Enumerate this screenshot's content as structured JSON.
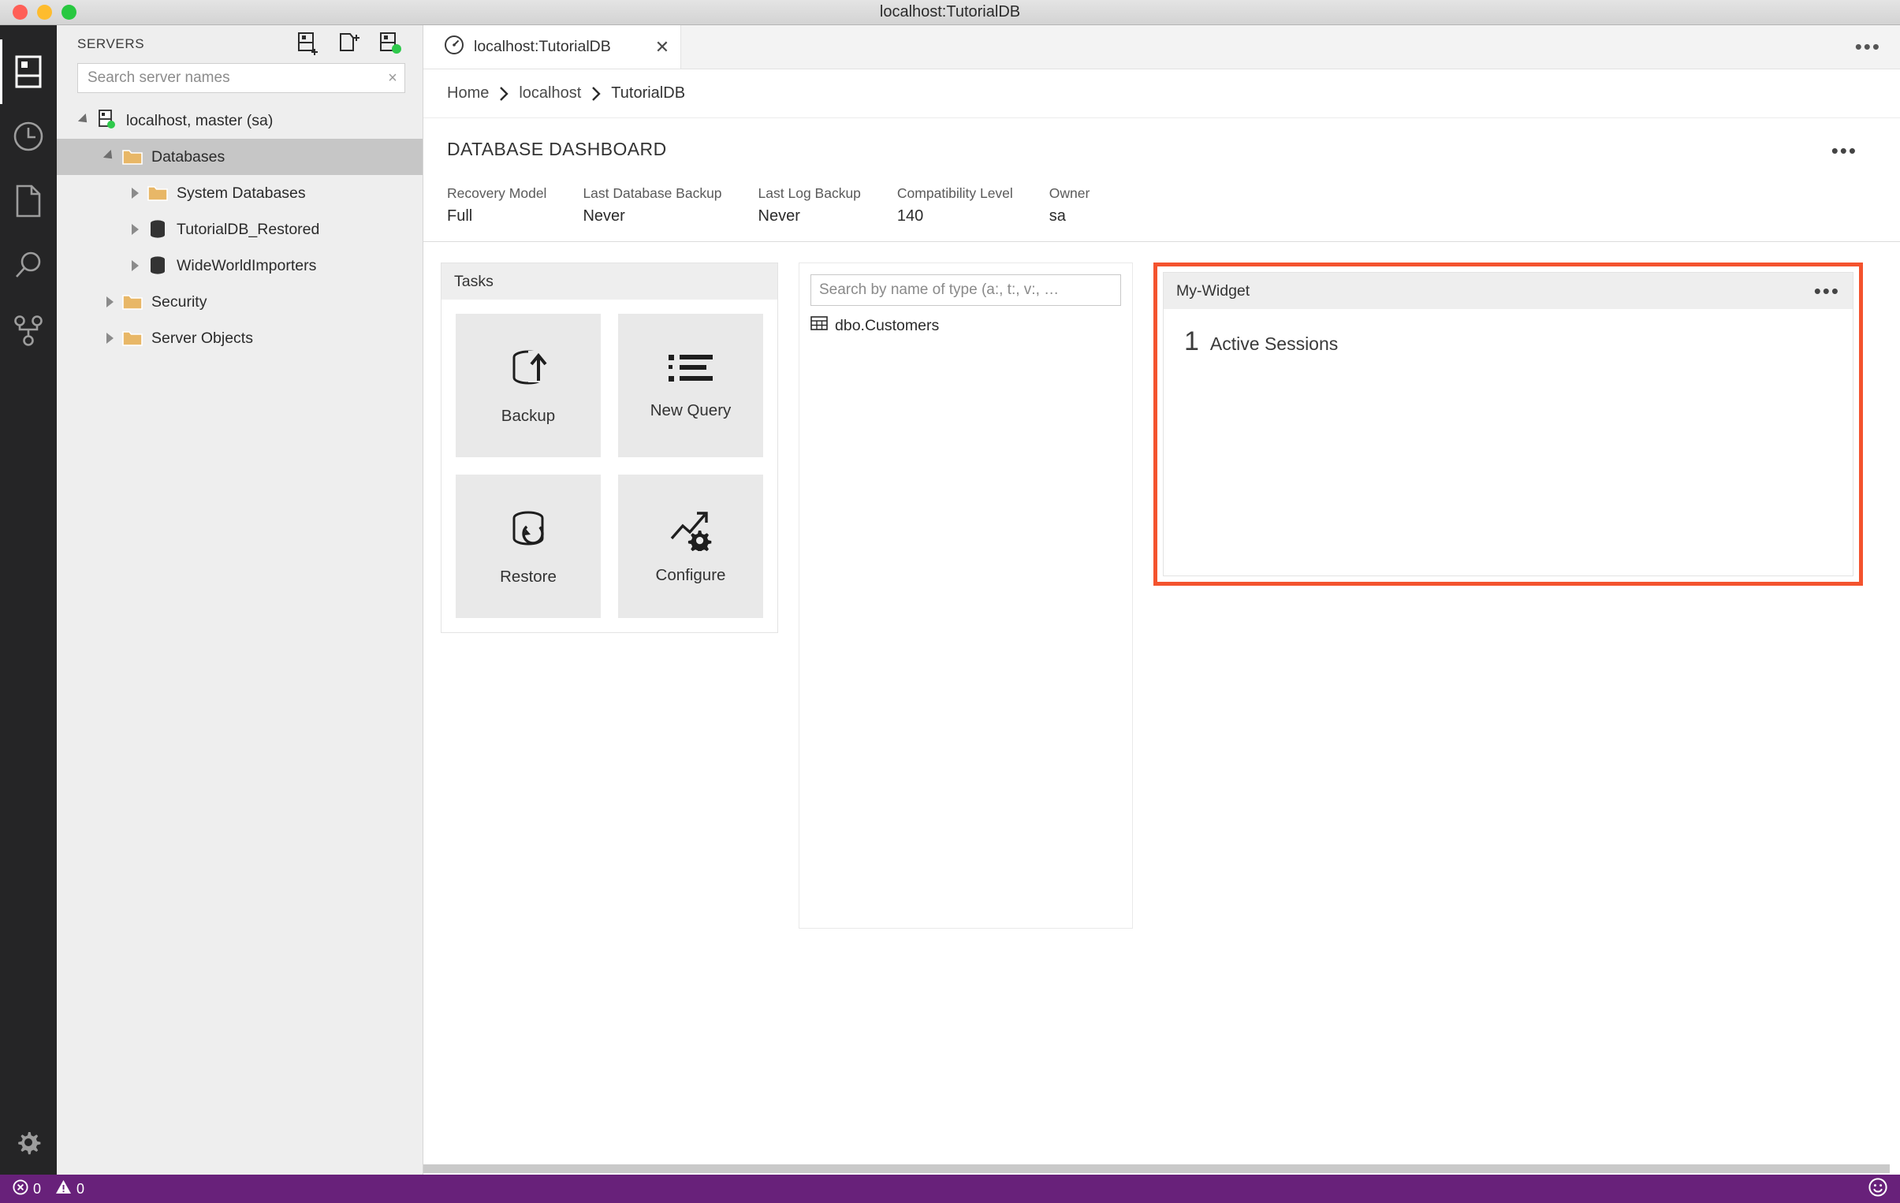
{
  "window": {
    "title": "localhost:TutorialDB",
    "traffic_lights": [
      "close",
      "minimize",
      "zoom"
    ]
  },
  "activitybar": {
    "items": [
      {
        "name": "servers",
        "icon": "servers-icon",
        "active": true
      },
      {
        "name": "history",
        "icon": "clock-icon",
        "active": false
      },
      {
        "name": "files",
        "icon": "file-icon",
        "active": false
      },
      {
        "name": "search",
        "icon": "search-icon",
        "active": false
      },
      {
        "name": "source-control",
        "icon": "source-control-icon",
        "active": false
      }
    ],
    "bottom": {
      "name": "manage",
      "icon": "gear-icon"
    }
  },
  "sidebar": {
    "title": "SERVERS",
    "actions": [
      {
        "name": "new-connection",
        "icon": "add-connection-icon"
      },
      {
        "name": "new-server-group",
        "icon": "add-server-group-icon"
      },
      {
        "name": "show-active-connections",
        "icon": "active-connections-icon"
      }
    ],
    "search": {
      "placeholder": "Search server names",
      "value": "",
      "clear": "×"
    },
    "tree": [
      {
        "label": "localhost, master (sa)",
        "indent": 0,
        "state": "expanded",
        "icon": "server-connected-icon",
        "selected": false
      },
      {
        "label": "Databases",
        "indent": 1,
        "state": "expanded",
        "icon": "folder-icon",
        "selected": true
      },
      {
        "label": "System Databases",
        "indent": 2,
        "state": "collapsed",
        "icon": "folder-icon",
        "selected": false
      },
      {
        "label": "TutorialDB_Restored",
        "indent": 2,
        "state": "collapsed",
        "icon": "database-icon",
        "selected": false
      },
      {
        "label": "WideWorldImporters",
        "indent": 2,
        "state": "collapsed",
        "icon": "database-icon",
        "selected": false
      },
      {
        "label": "Security",
        "indent": 1,
        "state": "collapsed",
        "icon": "folder-icon",
        "selected": false
      },
      {
        "label": "Server Objects",
        "indent": 1,
        "state": "collapsed",
        "icon": "folder-icon",
        "selected": false
      }
    ]
  },
  "tabbar": {
    "tabs": [
      {
        "label": "localhost:TutorialDB",
        "icon": "dashboard-icon",
        "active": true,
        "close": "✕"
      }
    ],
    "more": "•••"
  },
  "breadcrumb": {
    "items": [
      "Home",
      "localhost",
      "TutorialDB"
    ],
    "separator": "›"
  },
  "dashboard": {
    "title": "DATABASE DASHBOARD",
    "more": "•••",
    "properties": [
      {
        "label": "Recovery Model",
        "value": "Full"
      },
      {
        "label": "Last Database Backup",
        "value": "Never"
      },
      {
        "label": "Last Log Backup",
        "value": "Never"
      },
      {
        "label": "Compatibility Level",
        "value": "140"
      },
      {
        "label": "Owner",
        "value": "sa"
      }
    ]
  },
  "widgets": {
    "tasks": {
      "title": "Tasks",
      "tiles": [
        {
          "label": "Backup",
          "icon": "backup-icon"
        },
        {
          "label": "New Query",
          "icon": "new-query-icon"
        },
        {
          "label": "Restore",
          "icon": "restore-icon"
        },
        {
          "label": "Configure",
          "icon": "configure-icon"
        }
      ]
    },
    "explorer": {
      "search": {
        "placeholder": "Search by name of type (a:, t:, v:, …",
        "value": ""
      },
      "items": [
        {
          "label": "dbo.Customers",
          "icon": "table-icon"
        }
      ]
    },
    "my_widget": {
      "title": "My-Widget",
      "more": "•••",
      "highlighted": true,
      "highlight_color": "#f4532e",
      "metric": {
        "value": "1",
        "label": "Active Sessions"
      }
    }
  },
  "statusbar": {
    "background": "#68217a",
    "errors": {
      "icon": "error-icon",
      "count": "0"
    },
    "warnings": {
      "icon": "warning-icon",
      "count": "0"
    },
    "feedback": {
      "icon": "smiley-icon"
    }
  }
}
